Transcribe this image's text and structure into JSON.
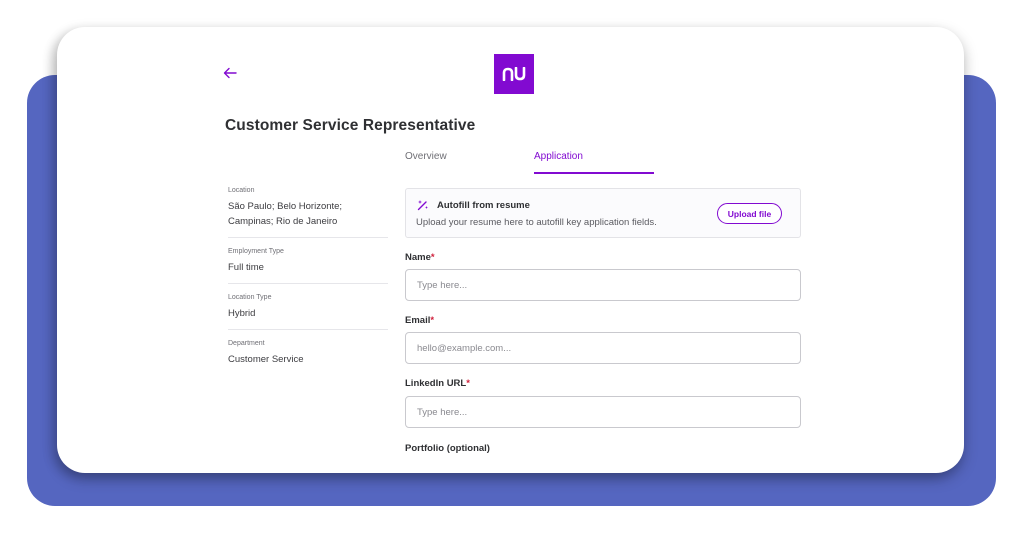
{
  "header": {
    "logo_text": "nu",
    "brand_color": "#820ad1",
    "back_icon": "arrow-left-icon"
  },
  "job": {
    "title": "Customer Service Representative"
  },
  "tabs": [
    {
      "label": "Overview",
      "active": false
    },
    {
      "label": "Application",
      "active": true
    }
  ],
  "details": [
    {
      "label": "Location",
      "value": "São Paulo; Belo Horizonte; Campinas; Rio de Janeiro"
    },
    {
      "label": "Employment Type",
      "value": "Full time"
    },
    {
      "label": "Location Type",
      "value": "Hybrid"
    },
    {
      "label": "Department",
      "value": "Customer Service"
    }
  ],
  "autofill": {
    "icon": "magic-wand-icon",
    "title": "Autofill from resume",
    "description": "Upload your resume here to autofill key application fields.",
    "button_label": "Upload file"
  },
  "form": {
    "name": {
      "label": "Name",
      "required_mark": "*",
      "placeholder": "Type here...",
      "value": ""
    },
    "email": {
      "label": "Email",
      "required_mark": "*",
      "placeholder": "hello@example.com...",
      "value": ""
    },
    "linkedin": {
      "label": "LinkedIn URL",
      "required_mark": "*",
      "placeholder": "Type here...",
      "value": ""
    },
    "portfolio": {
      "label": "Portfolio (optional)"
    }
  },
  "colors": {
    "accent": "#820ad1",
    "required": "#d0213c",
    "backdrop": "#5566c0"
  }
}
